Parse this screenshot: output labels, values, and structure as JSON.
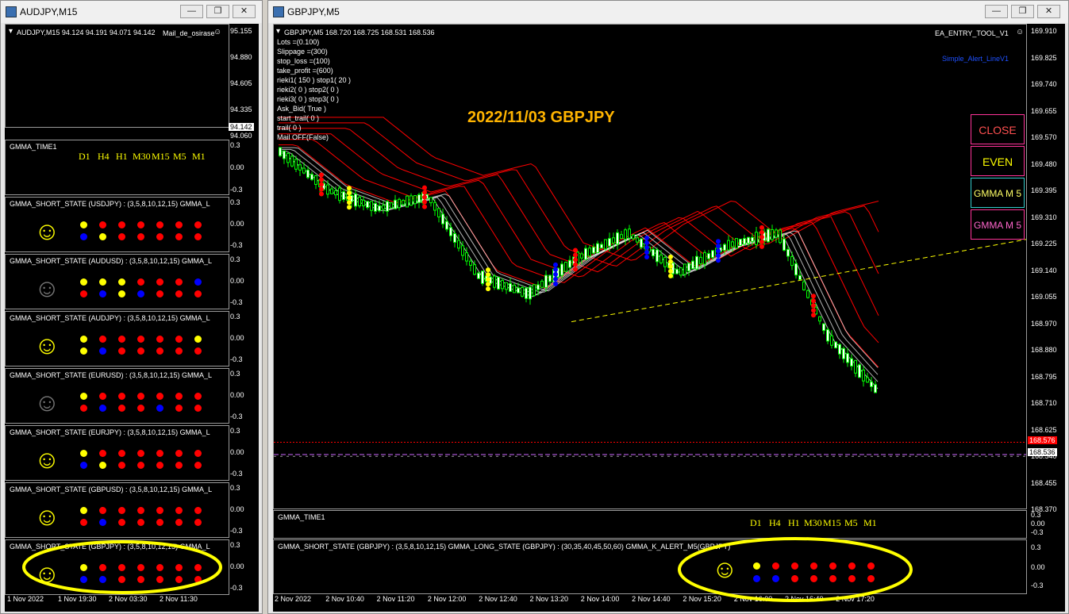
{
  "left_window": {
    "title": "AUDJPY,M15",
    "minimize": "—",
    "restore": "❐",
    "close": "✕",
    "symbol_line": "AUDJPY,M15  94.124 94.191 94.071 94.142",
    "ea_label": "Mail_de_osirase",
    "price_axis": [
      "95.155",
      "94.880",
      "94.605",
      "94.335",
      "94.142",
      "94.060"
    ],
    "time_label": "GMMA_TIME1",
    "timeframes": [
      "D1",
      "H4",
      "H1",
      "M30",
      "M15",
      "M5",
      "M1"
    ],
    "time_axis": [
      "0.3",
      "0.00",
      "-0.3"
    ],
    "subpanels": [
      {
        "label": "GMMA_SHORT_STATE (USDJPY) : (3,5,8,10,12,15)  GMMA_L",
        "face": "yellow",
        "axis": [
          "0.3",
          "0.00",
          "-0.3"
        ],
        "row1": [
          "yellow",
          "red",
          "red",
          "red",
          "red",
          "red",
          "red"
        ],
        "row2": [
          "blue",
          "yellow",
          "red",
          "red",
          "red",
          "red",
          "red"
        ]
      },
      {
        "label": "GMMA_SHORT_STATE (AUDUSD) : (3,5,8,10,12,15)  GMMA_L",
        "face": "gray",
        "axis": [
          "0.3",
          "0.00",
          "-0.3"
        ],
        "row1": [
          "yellow",
          "yellow",
          "yellow",
          "red",
          "red",
          "red",
          "blue"
        ],
        "row2": [
          "red",
          "blue",
          "yellow",
          "blue",
          "red",
          "red",
          "red"
        ]
      },
      {
        "label": "GMMA_SHORT_STATE (AUDJPY) : (3,5,8,10,12,15)  GMMA_L",
        "face": "yellow",
        "axis": [
          "0.3",
          "0.00",
          "-0.3"
        ],
        "row1": [
          "yellow",
          "red",
          "red",
          "red",
          "red",
          "red",
          "yellow"
        ],
        "row2": [
          "yellow",
          "blue",
          "red",
          "red",
          "red",
          "red",
          "red"
        ]
      },
      {
        "label": "GMMA_SHORT_STATE (EURUSD) : (3,5,8,10,12,15)  GMMA_L",
        "face": "gray",
        "axis": [
          "0.3",
          "0.00",
          "-0.3"
        ],
        "row1": [
          "yellow",
          "red",
          "red",
          "red",
          "red",
          "red",
          "red"
        ],
        "row2": [
          "red",
          "blue",
          "red",
          "red",
          "blue",
          "red",
          "red"
        ]
      },
      {
        "label": "GMMA_SHORT_STATE (EURJPY) : (3,5,8,10,12,15)  GMMA_L",
        "face": "yellow",
        "axis": [
          "0.3",
          "0.00",
          "-0.3"
        ],
        "row1": [
          "yellow",
          "red",
          "red",
          "red",
          "red",
          "red",
          "red"
        ],
        "row2": [
          "blue",
          "yellow",
          "red",
          "red",
          "red",
          "red",
          "red"
        ]
      },
      {
        "label": "GMMA_SHORT_STATE (GBPUSD) : (3,5,8,10,12,15)  GMMA_L",
        "face": "yellow",
        "axis": [
          "0.3",
          "0.00",
          "-0.3"
        ],
        "row1": [
          "yellow",
          "red",
          "red",
          "red",
          "red",
          "red",
          "red"
        ],
        "row2": [
          "red",
          "blue",
          "red",
          "red",
          "red",
          "red",
          "red"
        ]
      },
      {
        "label": "GMMA_SHORT_STATE (GBPJPY) : (3,5,8,10,12,15)  GMMA_L",
        "face": "yellow",
        "axis": [
          "0.3",
          "0.00",
          "-0.3"
        ],
        "row1": [
          "yellow",
          "red",
          "red",
          "red",
          "red",
          "red",
          "red"
        ],
        "row2": [
          "blue",
          "blue",
          "red",
          "red",
          "red",
          "red",
          "red"
        ]
      }
    ],
    "date_axis": [
      "1 Nov 2022",
      "1 Nov 19:30",
      "2 Nov 03:30",
      "2 Nov 11:30"
    ]
  },
  "right_window": {
    "title": "GBPJPY,M5",
    "minimize": "—",
    "restore": "❐",
    "close": "✕",
    "symbol_line": "GBPJPY,M5  168.720 168.725 168.531 168.536",
    "ea_label": "EA_ENTRY_TOOL_V1",
    "alert_label": "Simple_Alert_LineV1",
    "chart_title": "2022/11/03 GBPJPY",
    "params": [
      "Lots =(0.100)",
      "Slippage =(300)",
      "stop_loss =(100)",
      "take_profit =(600)",
      "rieki1( 150 ) stop1( 20 )",
      "rieki2( 0 ) stop2( 0 )",
      "rieki3( 0 ) stop3( 0 )",
      "Ask_Bid( True )",
      "start_trail( 0 )",
      "trail( 0 )",
      "Mail OFF(False)"
    ],
    "buttons": [
      {
        "label": "CLOSE",
        "color": "#ff5050",
        "border": "#ff3399"
      },
      {
        "label": "EVEN",
        "color": "#ffff00",
        "border": "#ff3399"
      },
      {
        "label": "GMMA M 5",
        "color": "#ffff66",
        "border": "#33cccc"
      },
      {
        "label": "GMMA M 5",
        "color": "#ff66cc",
        "border": "#ff3399"
      }
    ],
    "price_axis": [
      "169.910",
      "169.825",
      "169.740",
      "169.655",
      "169.570",
      "169.480",
      "169.395",
      "169.310",
      "169.225",
      "169.140",
      "169.055",
      "168.970",
      "168.880",
      "168.795",
      "168.710",
      "168.625",
      "168.540",
      "168.455",
      "168.370"
    ],
    "ask_price": "168.576",
    "bid_price": "168.536",
    "time_label": "GMMA_TIME1",
    "timeframes": [
      "D1",
      "H4",
      "H1",
      "M30",
      "M15",
      "M5",
      "M1"
    ],
    "time_axis": [
      "0.3",
      "0.00",
      "-0.3"
    ],
    "state_label": "GMMA_SHORT_STATE (GBPJPY) : (3,5,8,10,12,15)  GMMA_LONG_STATE (GBPJPY) : (30,35,40,45,50,60)  GMMA_K_ALERT_M5(GBPJPY)",
    "state_axis": [
      "0.3",
      "0.00",
      "-0.3"
    ],
    "state_row1": [
      "yellow",
      "red",
      "red",
      "red",
      "red",
      "red",
      "red"
    ],
    "state_row2": [
      "blue",
      "blue",
      "red",
      "red",
      "red",
      "red",
      "red"
    ],
    "date_axis": [
      "2 Nov 2022",
      "2 Nov 10:40",
      "2 Nov 11:20",
      "2 Nov 12:00",
      "2 Nov 12:40",
      "2 Nov 13:20",
      "2 Nov 14:00",
      "2 Nov 14:40",
      "2 Nov 15:20",
      "2 Nov 16:00",
      "2 Nov 16:40",
      "2 Nov 17:20"
    ]
  },
  "colors": {
    "yellow": "#ffff00",
    "red": "#ff0000",
    "blue": "#0000ff",
    "gray": "#777777",
    "highlight": "#ffff00"
  },
  "chart_data": {
    "type": "line",
    "title": "2022/11/03 GBPJPY",
    "xlabel": "",
    "ylabel": "",
    "x": [
      "2 Nov 2022",
      "2 Nov 10:40",
      "2 Nov 11:20",
      "2 Nov 12:00",
      "2 Nov 12:40",
      "2 Nov 13:20",
      "2 Nov 14:00",
      "2 Nov 14:40",
      "2 Nov 15:20",
      "2 Nov 16:00",
      "2 Nov 16:40",
      "2 Nov 17:20"
    ],
    "ylim": [
      168.37,
      169.91
    ],
    "series": [
      {
        "values": [
          169.53,
          169.4,
          169.34,
          169.38,
          169.12,
          169.06,
          169.18,
          169.26,
          169.13,
          169.22,
          169.26,
          168.92,
          168.74
        ]
      }
    ]
  }
}
